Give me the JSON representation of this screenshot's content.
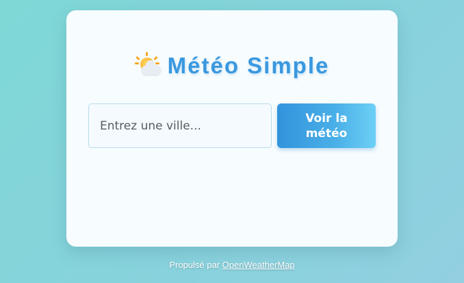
{
  "header": {
    "icon": "sun-behind-cloud-icon",
    "title": "Météo Simple"
  },
  "search": {
    "placeholder": "Entrez une ville...",
    "value": "",
    "button_label": "Voir la météo"
  },
  "footer": {
    "prefix": "Propulsé par",
    "link_label": "OpenWeatherMap"
  },
  "colors": {
    "title": "#3a98df",
    "button_start": "#3293dc",
    "button_end": "#6dd0f5",
    "background_start": "#7fd8d6",
    "background_end": "#92cfe0"
  }
}
